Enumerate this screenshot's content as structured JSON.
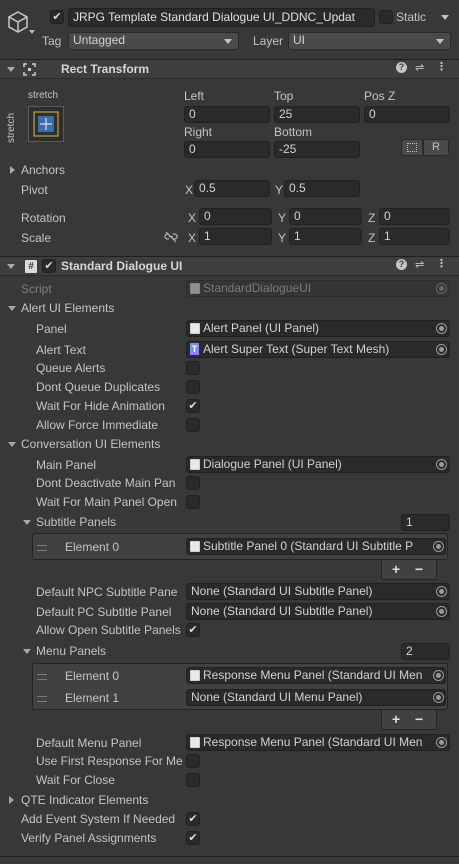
{
  "header": {
    "name": "JRPG Template Standard Dialogue UI_DDNC_Updat",
    "static_label": "Static",
    "tag_label": "Tag",
    "tag_value": "Untagged",
    "layer_label": "Layer",
    "layer_value": "UI"
  },
  "rect_transform": {
    "title": "Rect Transform",
    "stretch_top": "stretch",
    "stretch_side": "stretch",
    "left_label": "Left",
    "left_value": "0",
    "top_label": "Top",
    "top_value": "25",
    "posz_label": "Pos Z",
    "posz_value": "0",
    "right_label": "Right",
    "right_value": "0",
    "bottom_label": "Bottom",
    "bottom_value": "-25",
    "r_button": "R",
    "anchors_label": "Anchors",
    "pivot_label": "Pivot",
    "pivot_x_label": "X",
    "pivot_x": "0.5",
    "pivot_y_label": "Y",
    "pivot_y": "0.5",
    "rotation_label": "Rotation",
    "rot_x_label": "X",
    "rot_x": "0",
    "rot_y_label": "Y",
    "rot_y": "0",
    "rot_z_label": "Z",
    "rot_z": "0",
    "scale_label": "Scale",
    "scale_x_label": "X",
    "scale_x": "1",
    "scale_y_label": "Y",
    "scale_y": "1",
    "scale_z_label": "Z",
    "scale_z": "1"
  },
  "dialogue": {
    "title": "Standard Dialogue UI",
    "script_label": "Script",
    "script_value": "StandardDialogueUI",
    "alert_section": "Alert UI Elements",
    "panel_label": "Panel",
    "panel_value": "Alert Panel (UI Panel)",
    "alert_text_label": "Alert Text",
    "alert_text_value": "Alert Super Text (Super Text Mesh)",
    "queue_alerts_label": "Queue Alerts",
    "dont_queue_label": "Dont Queue Duplicates",
    "wait_hide_label": "Wait For Hide Animation",
    "allow_force_label": "Allow Force Immediate",
    "conversation_section": "Conversation UI Elements",
    "main_panel_label": "Main Panel",
    "main_panel_value": "Dialogue Panel (UI Panel)",
    "dont_deactivate_label": "Dont Deactivate Main Pan",
    "wait_main_label": "Wait For Main Panel Open",
    "subtitle_panels_label": "Subtitle Panels",
    "subtitle_panels_count": "1",
    "subtitle_el0_label": "Element 0",
    "subtitle_el0_value": "Subtitle Panel 0 (Standard UI Subtitle P",
    "default_npc_label": "Default NPC Subtitle Pane",
    "default_npc_value": "None (Standard UI Subtitle Panel)",
    "default_pc_label": "Default PC Subtitle Panel",
    "default_pc_value": "None (Standard UI Subtitle Panel)",
    "allow_open_label": "Allow Open Subtitle Panels",
    "menu_panels_label": "Menu Panels",
    "menu_panels_count": "2",
    "menu_el0_label": "Element 0",
    "menu_el0_value": "Response Menu Panel (Standard UI Men",
    "menu_el1_label": "Element 1",
    "menu_el1_value": "None (Standard UI Menu Panel)",
    "default_menu_label": "Default Menu Panel",
    "default_menu_value": "Response Menu Panel (Standard UI Men",
    "use_first_label": "Use First Response For Me",
    "wait_close_label": "Wait For Close",
    "qte_section": "QTE Indicator Elements",
    "add_event_label": "Add Event System If Needed",
    "verify_label": "Verify Panel Assignments",
    "plus": "+",
    "minus": "−"
  },
  "checkboxes": {
    "active": true,
    "static": false,
    "rect_enabled": true,
    "dialogue_enabled": true,
    "queue_alerts": false,
    "dont_queue": false,
    "wait_hide": true,
    "allow_force": false,
    "dont_deactivate": false,
    "wait_main": false,
    "allow_open": true,
    "use_first": false,
    "wait_close": false,
    "add_event": true,
    "verify": true
  }
}
